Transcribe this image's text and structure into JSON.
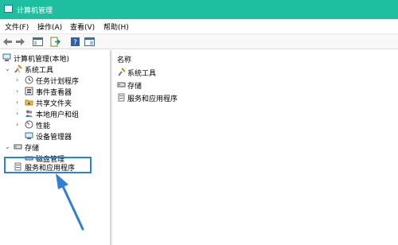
{
  "window": {
    "title": "计算机管理",
    "accent": "#1ebfa0"
  },
  "menu": [
    "文件(F)",
    "操作(A)",
    "查看(V)",
    "帮助(H)"
  ],
  "toolbar": [
    "back-icon",
    "forward-icon",
    "show-hide-console-tree-icon",
    "export-list-icon",
    "help-icon",
    "properties-icon"
  ],
  "tree": {
    "root": "计算机管理(本地)",
    "system_tools": "系统工具",
    "children": [
      "任务计划程序",
      "事件查看器",
      "共享文件夹",
      "本地用户和组",
      "性能",
      "设备管理器"
    ],
    "storage": "存储",
    "storage_children": [
      "磁盘管理"
    ],
    "services": "服务和应用程序"
  },
  "list": {
    "header": "名称",
    "items": [
      "系统工具",
      "存储",
      "服务和应用程序"
    ]
  },
  "annotation": {
    "color": "#2f7fd6"
  }
}
